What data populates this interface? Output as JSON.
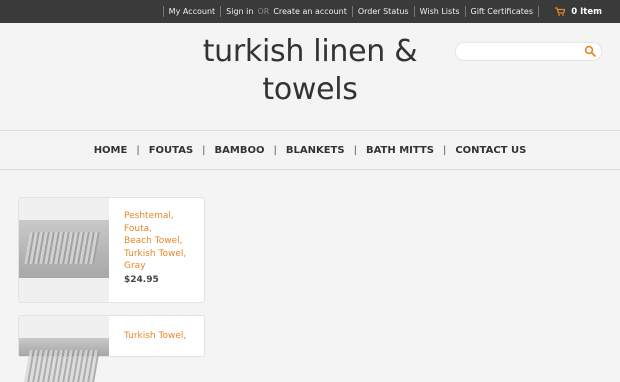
{
  "topbar": {
    "links": [
      "My Account",
      "Sign in",
      "Create an account",
      "Order Status",
      "Wish Lists",
      "Gift Certificates"
    ],
    "or_text": "OR",
    "cart_label": "0 Item"
  },
  "header": {
    "logo_line1": "turkish linen &",
    "logo_line2": "towels",
    "search_placeholder": ""
  },
  "nav": {
    "items": [
      "HOME",
      "FOUTAS",
      "BAMBOO",
      "BLANKETS",
      "BATH MITTS",
      "CONTACT US"
    ],
    "separator": "|"
  },
  "products": [
    {
      "name_lines": [
        "Peshtemal, Fouta,",
        "Beach Towel,",
        "Turkish Towel,",
        "Gray"
      ],
      "price": "$24.95"
    },
    {
      "name_lines": [
        "Turkish Towel,"
      ]
    }
  ],
  "colors": {
    "topbar_bg": "#3a3a3a",
    "accent_orange": "#e8862a",
    "page_bg": "#f4f4f4"
  }
}
